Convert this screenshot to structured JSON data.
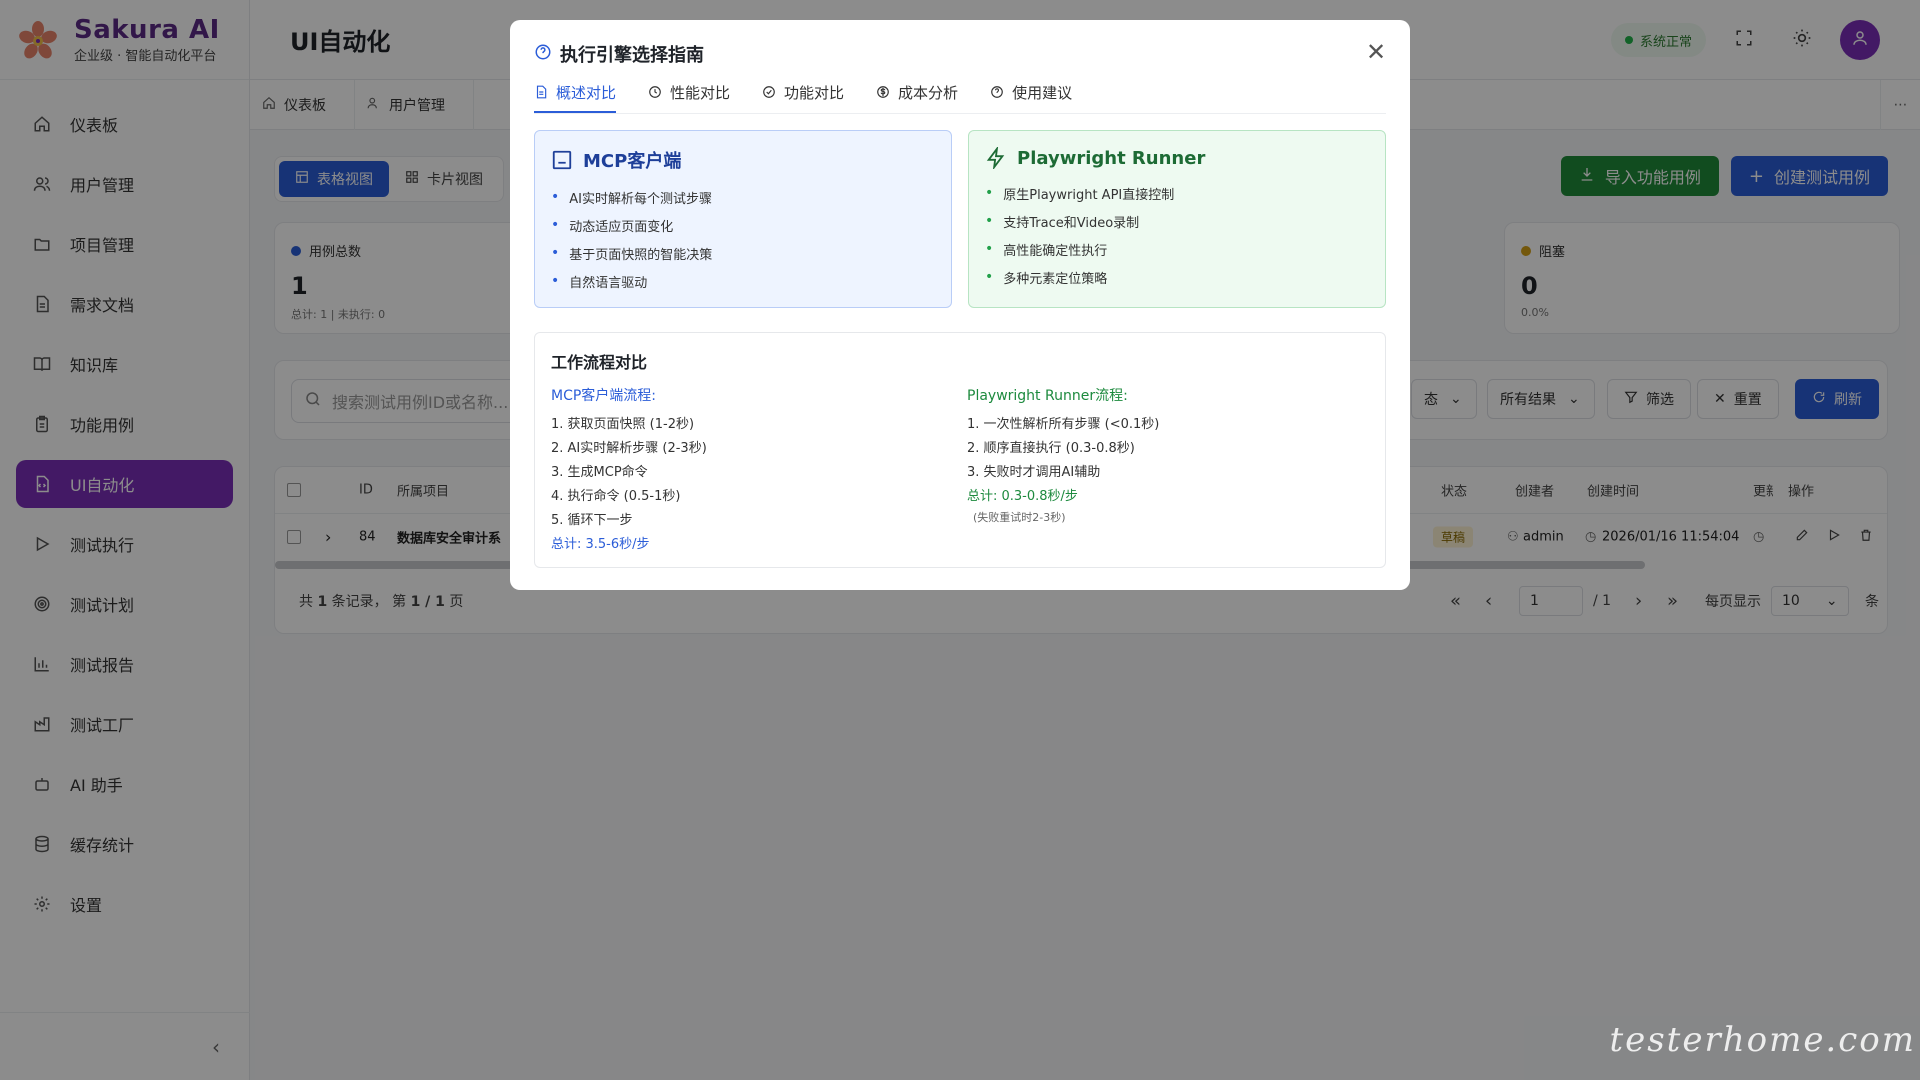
{
  "brand": {
    "name": "Sakura AI",
    "subtitle": "企业级 · 智能自动化平台"
  },
  "sidebar": {
    "items": [
      {
        "label": "仪表板",
        "icon": "home-icon"
      },
      {
        "label": "用户管理",
        "icon": "users-icon"
      },
      {
        "label": "项目管理",
        "icon": "folder-icon"
      },
      {
        "label": "需求文档",
        "icon": "document-icon"
      },
      {
        "label": "知识库",
        "icon": "book-icon"
      },
      {
        "label": "功能用例",
        "icon": "clipboard-icon"
      },
      {
        "label": "UI自动化",
        "icon": "code-file-icon",
        "active": true
      },
      {
        "label": "测试执行",
        "icon": "play-icon"
      },
      {
        "label": "测试计划",
        "icon": "target-icon"
      },
      {
        "label": "测试报告",
        "icon": "bar-chart-icon"
      },
      {
        "label": "测试工厂",
        "icon": "factory-icon"
      },
      {
        "label": "AI 助手",
        "icon": "bot-icon"
      },
      {
        "label": "缓存统计",
        "icon": "database-icon"
      },
      {
        "label": "设置",
        "icon": "gear-icon"
      }
    ],
    "collapse_icon": "chevron-left-icon"
  },
  "header": {
    "title": "UI自动化",
    "status": "系统正常",
    "status_color": "#22b34a"
  },
  "page_tabs": [
    {
      "label": "仪表板",
      "icon": "home-icon"
    },
    {
      "label": "用户管理",
      "icon": "users-icon"
    }
  ],
  "toolbar": {
    "table_view": "表格视图",
    "card_view": "卡片视图",
    "import_label": "导入功能用例",
    "create_label": "创建测试用例"
  },
  "stats": {
    "total": {
      "label": "用例总数",
      "value": "1",
      "sub": "总计: 1 | 未执行: 0",
      "color": "#2b5dd8"
    },
    "blocked": {
      "label": "阻塞",
      "value": "0",
      "sub": "0.0%",
      "color": "#d4a017"
    }
  },
  "filters": {
    "search_placeholder": "搜索测试用例ID或名称...",
    "status_partial": "态",
    "result_select": "所有结果",
    "filter_label": "筛选",
    "reset_label": "重置",
    "refresh_label": "刷新"
  },
  "table": {
    "headers": {
      "id": "ID",
      "project": "所属项目",
      "status": "状态",
      "creator": "创建者",
      "created": "创建时间",
      "updated": "更新",
      "actions": "操作"
    },
    "rows": [
      {
        "id": "84",
        "project": "数据库安全审计系",
        "status": "草稿",
        "creator": "admin",
        "created": "2026/01/16 11:54:04"
      }
    ]
  },
  "pager": {
    "summary_prefix": "共",
    "summary_count": "1",
    "summary_mid": "条记录， 第",
    "summary_page": "1 / 1",
    "summary_suffix": "页",
    "current_page": "1",
    "total_pages": "/ 1",
    "per_page_label": "每页显示",
    "per_page": "10",
    "unit": "条"
  },
  "modal": {
    "title": "执行引擎选择指南",
    "tabs": [
      {
        "label": "概述对比",
        "icon": "document-icon",
        "active": true
      },
      {
        "label": "性能对比",
        "icon": "clock-icon"
      },
      {
        "label": "功能对比",
        "icon": "check-circle-icon"
      },
      {
        "label": "成本分析",
        "icon": "dollar-icon"
      },
      {
        "label": "使用建议",
        "icon": "help-icon"
      }
    ],
    "mcp": {
      "title": "MCP客户端",
      "points": [
        "AI实时解析每个测试步骤",
        "动态适应页面变化",
        "基于页面快照的智能决策",
        "自然语言驱动"
      ]
    },
    "playwright": {
      "title": "Playwright Runner",
      "points": [
        "原生Playwright API直接控制",
        "支持Trace和Video录制",
        "高性能确定性执行",
        "多种元素定位策略"
      ]
    },
    "flow": {
      "title": "工作流程对比",
      "left": {
        "head": "MCP客户端流程:",
        "steps": [
          "1. 获取页面快照 (1-2秒)",
          "2. AI实时解析步骤 (2-3秒)",
          "3. 生成MCP命令",
          "4. 执行命令 (0.5-1秒)",
          "5. 循环下一步"
        ],
        "total": "总计: 3.5-6秒/步"
      },
      "right": {
        "head": "Playwright Runner流程:",
        "steps": [
          "1. 一次性解析所有步骤 (<0.1秒)",
          "2. 顺序直接执行 (0.3-0.8秒)",
          "3. 失败时才调用AI辅助"
        ],
        "total": "总计: 0.3-0.8秒/步",
        "note": "(失败重试时2-3秒)"
      }
    }
  },
  "watermark": "testerhome.com"
}
